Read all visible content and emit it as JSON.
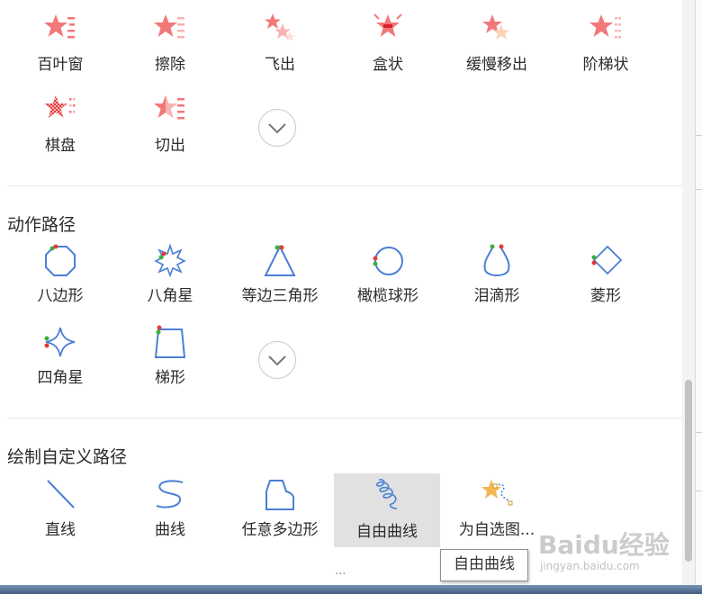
{
  "colors": {
    "star": "#f2787a",
    "path_line": "#4a7fd6",
    "start_dot": "#3cae3c",
    "end_dot": "#e23b3b"
  },
  "exit_effects": {
    "items": [
      {
        "label": "百叶窗",
        "icon": "blinds-star-icon"
      },
      {
        "label": "擦除",
        "icon": "wipe-star-icon"
      },
      {
        "label": "飞出",
        "icon": "fly-out-star-icon"
      },
      {
        "label": "盒状",
        "icon": "box-star-icon"
      },
      {
        "label": "缓慢移出",
        "icon": "crawl-out-star-icon"
      },
      {
        "label": "阶梯状",
        "icon": "step-star-icon"
      },
      {
        "label": "棋盘",
        "icon": "checkerboard-star-icon"
      },
      {
        "label": "切出",
        "icon": "cut-star-icon"
      }
    ]
  },
  "motion_paths": {
    "title": "动作路径",
    "items": [
      {
        "label": "八边形",
        "icon": "octagon-path-icon"
      },
      {
        "label": "八角星",
        "icon": "eight-point-star-path-icon"
      },
      {
        "label": "等边三角形",
        "icon": "triangle-path-icon"
      },
      {
        "label": "橄榄球形",
        "icon": "football-path-icon"
      },
      {
        "label": "泪滴形",
        "icon": "teardrop-path-icon"
      },
      {
        "label": "菱形",
        "icon": "diamond-path-icon"
      },
      {
        "label": "四角星",
        "icon": "four-point-star-path-icon"
      },
      {
        "label": "梯形",
        "icon": "trapezoid-path-icon"
      }
    ]
  },
  "custom_paths": {
    "title": "绘制自定义路径",
    "items": [
      {
        "label": "直线",
        "icon": "line-path-icon"
      },
      {
        "label": "曲线",
        "icon": "curve-path-icon"
      },
      {
        "label": "任意多边形",
        "icon": "freeform-polygon-icon"
      },
      {
        "label": "自由曲线",
        "icon": "scribble-path-icon",
        "selected": true
      },
      {
        "label": "为自选图...",
        "icon": "shape-path-icon"
      }
    ]
  },
  "tooltip": "自由曲线",
  "footer": {
    "ellipsis": "..."
  },
  "watermark": {
    "brand": "Baidu经验",
    "url": "jingyan.baidu.com"
  }
}
